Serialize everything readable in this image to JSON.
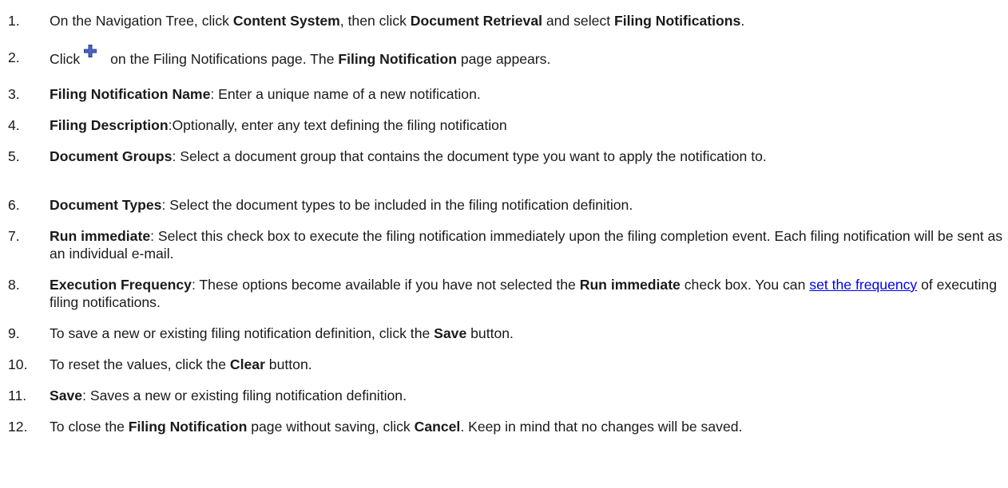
{
  "steps": [
    {
      "num": "1.",
      "p1": "On the Navigation Tree, click ",
      "b1": "Content System",
      "p2": ", then click ",
      "b2": "Document Retrieval",
      "p3": " and select ",
      "b3": "Filing Notifications",
      "p4": "."
    },
    {
      "num": "2.",
      "p1": "Click",
      "icon": "plus-icon",
      "p2": "on the Filing Notifications page. The ",
      "b1": "Filing Notification",
      "p3": " page appears."
    },
    {
      "num": "3.",
      "b1": "Filing Notification Name",
      "p1": ": Enter a unique name of a new notification."
    },
    {
      "num": "4.",
      "b1": "Filing Description",
      "p1": ":Optionally, enter any text defining the filing notification"
    },
    {
      "num": "5.",
      "b1": "Document Groups",
      "p1": ": Select a document group that contains the document type you want to apply the notification to."
    },
    {
      "num": "6.",
      "b1": "Document Types",
      "p1": ": Select the document types to be included in the filing notification definition."
    },
    {
      "num": "7.",
      "b1": "Run immediate",
      "p1": ": Select this check box to execute the filing notification immediately upon the filing completion event. Each filing notification will be sent as an individual e-mail."
    },
    {
      "num": "8.",
      "b1": "Execution Frequency",
      "p1": ": These options become available if you have not selected the ",
      "b2": "Run immediate",
      "p2": " check box. You can ",
      "link": "set the frequency",
      "p3": " of executing filing notifications."
    },
    {
      "num": "9.",
      "p1": "To save a new or existing filing notification definition, click the ",
      "b1": "Save",
      "p2": " button."
    },
    {
      "num": "10.",
      "p1": "To reset the values, click the ",
      "b1": "Clear",
      "p2": " button."
    },
    {
      "num": "11.",
      "b1": "Save",
      "p1": ": Saves a new or existing filing notification definition."
    },
    {
      "num": "12.",
      "p1": "To close the ",
      "b1": "Filing Notification",
      "p2": " page without saving, click ",
      "b2": "Cancel",
      "p3": ". Keep in mind that no changes will be saved."
    }
  ],
  "colors": {
    "text": "#1a1a1a",
    "link": "#0000ee",
    "plus_icon": "#2a3c8c"
  }
}
